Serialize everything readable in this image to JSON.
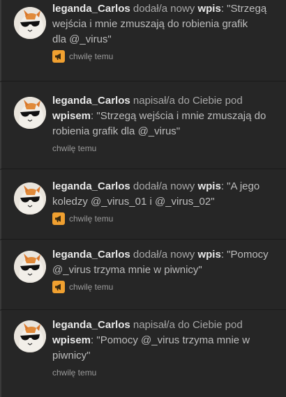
{
  "colors": {
    "background": "#262626",
    "author": "#e8e8e8",
    "text": "#b8b8b8",
    "badge": "#f0a030"
  },
  "notifications": [
    {
      "author": "leganda_Carlos",
      "lines": [
        {
          "verb": "dodał/a nowy",
          "keyword": "wpis",
          "after": ": \"Strzegą"
        },
        {
          "text": "wejścia i mnie zmuszają do robienia grafik"
        },
        {
          "text": "dla @_virus\""
        }
      ],
      "has_badge": true,
      "badge_icon": "megaphone-icon",
      "time": "chwilę temu"
    },
    {
      "author": "leganda_Carlos",
      "lines": [
        {
          "verb": "napisał/a do Ciebie pod"
        },
        {
          "keyword": "wpisem",
          "after": ": \"Strzegą wejścia i mnie zmuszają do"
        },
        {
          "text": "robienia grafik dla @_virus\""
        }
      ],
      "has_badge": false,
      "time": "chwilę temu"
    },
    {
      "author": "leganda_Carlos",
      "lines": [
        {
          "verb": "dodał/a nowy",
          "keyword": "wpis",
          "after": ": \"A jego"
        },
        {
          "text": "koledzy @_virus_01 i @_virus_02\""
        }
      ],
      "has_badge": true,
      "badge_icon": "megaphone-icon",
      "time": "chwilę temu"
    },
    {
      "author": "leganda_Carlos",
      "lines": [
        {
          "verb": "dodał/a nowy",
          "keyword": "wpis",
          "after": ": \"Pomocy"
        },
        {
          "text": "@_virus trzyma mnie w piwnicy\""
        }
      ],
      "has_badge": true,
      "badge_icon": "megaphone-icon",
      "time": "chwilę temu"
    },
    {
      "author": "leganda_Carlos",
      "lines": [
        {
          "verb": "napisał/a do Ciebie pod"
        },
        {
          "keyword": "wpisem",
          "after": ": \"Pomocy @_virus trzyma mnie w"
        },
        {
          "text": "piwnicy\""
        }
      ],
      "has_badge": false,
      "time": "chwilę temu"
    }
  ]
}
